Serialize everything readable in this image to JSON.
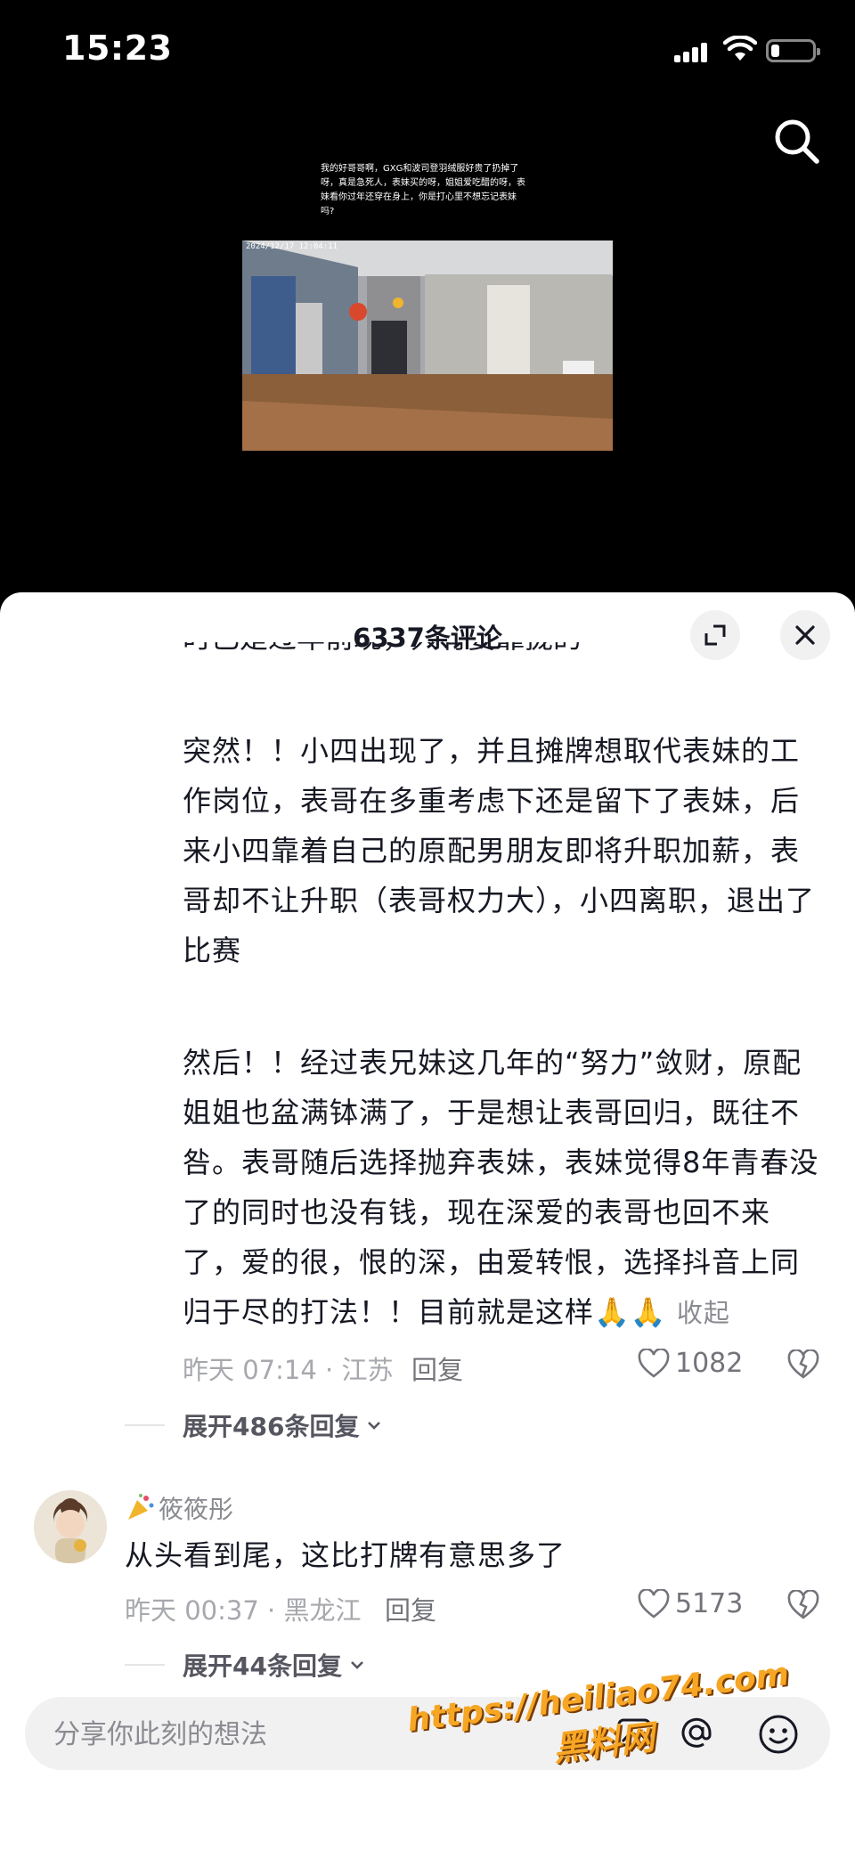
{
  "status_bar": {
    "time": "15:23"
  },
  "video": {
    "caption": "我的好哥哥啊，GXG和波司登羽绒服好贵了扔掉了呀，真是急死人，表妹买的呀，姐姐爱吃醋的呀，表妹看你过年还穿在身上，你是打心里不想忘记表妹吗?",
    "timestamp": "2024/12/17 12:04:11"
  },
  "comments_panel": {
    "title": "6337条评论",
    "comment1": {
      "clipped_line": "时已是过年前现，只有要靠拢的",
      "paragraph1": "突然！！小四出现了，并且摊牌想取代表妹的工作岗位，表哥在多重考虑下还是留下了表妹，后来小四靠着自己的原配男朋友即将升职加薪，表哥却不让升职（表哥权力大），小四离职，退出了比赛",
      "paragraph2": "然后！！经过表兄妹这几年的“努力”敛财，原配姐姐也盆满钵满了，于是想让表哥回归，既往不咎。表哥随后选择抛弃表妹，表妹觉得8年青春没了的同时也没有钱，现在深爱的表哥也回不来了，爱的很，恨的深，由爱转恨，选择抖音上同归于尽的打法！！目前就是这样",
      "emoji": "🙏🙏",
      "collapse_label": "收起",
      "meta": "昨天 07:14 · 江苏",
      "reply_label": "回复",
      "likes": "1082",
      "expand_label": "展开486条回复"
    },
    "comment2": {
      "username": "筱筱彤",
      "text": "从头看到尾，这比打牌有意思多了",
      "meta": "昨天 00:37 · 黑龙江",
      "reply_label": "回复",
      "likes": "5173",
      "expand_label": "展开44条回复"
    },
    "input": {
      "placeholder": "分享你此刻的想法"
    }
  },
  "watermark": {
    "line1": "https://heiliao74.com",
    "line2": "黑料网"
  },
  "colors": {
    "accent_watermark": "#f6a623",
    "text_primary": "#161823",
    "text_secondary": "#a7a8ad"
  }
}
